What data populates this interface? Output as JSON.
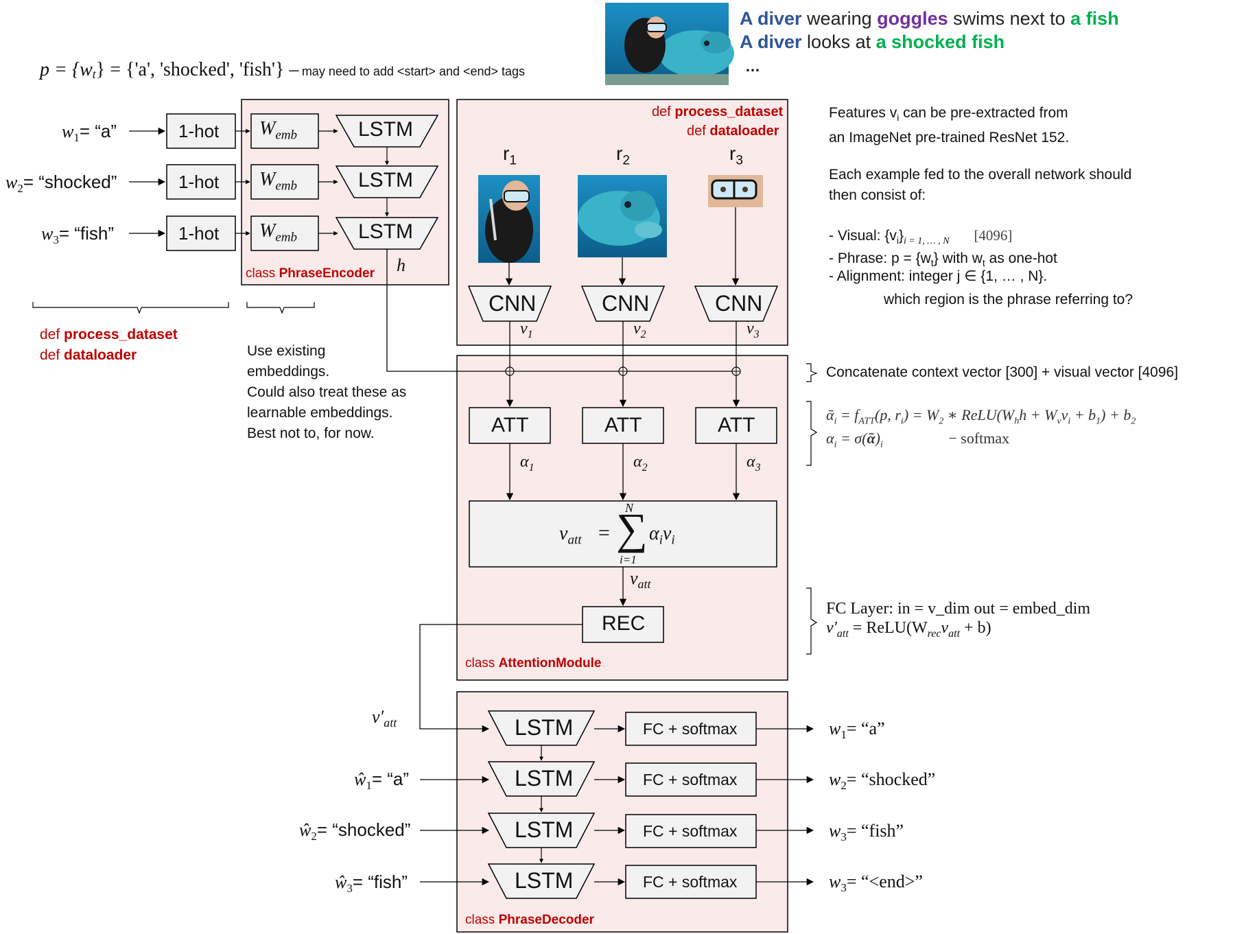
{
  "caption": {
    "line1": {
      "a": "A diver",
      "b": " wearing ",
      "c": "goggles",
      "d": " swims next to ",
      "e": "a fish"
    },
    "line2": {
      "a": "A diver",
      "b": " looks at ",
      "c": "a shocked fish"
    },
    "ellipsis": "…"
  },
  "phrase_def": {
    "formula": "p = {w",
    "sub": "t",
    "formula_end": "} = {'a', 'shocked', 'fish'} –",
    "note": "may need to add <start> and <end> tags"
  },
  "encoder": {
    "inputs": [
      {
        "w": "w",
        "sub": "1",
        "rest": "= “a”"
      },
      {
        "w": "w",
        "sub": "2",
        "rest": "= “shocked”"
      },
      {
        "w": "w",
        "sub": "3",
        "rest": "= “fish”"
      }
    ],
    "onehot_label": "1-hot",
    "wemb_label": "W",
    "wemb_sub": "emb",
    "lstm_label": "LSTM",
    "h_label": "h",
    "class_prefix": "class ",
    "class_name": "PhraseEncoder"
  },
  "left_notes": {
    "def1_prefix": "def ",
    "def1_name": "process_dataset",
    "def2_prefix": "def ",
    "def2_name": "dataloader",
    "embed_note": [
      "Use existing",
      "embeddings.",
      "Could also treat these as",
      "learnable embeddings.",
      "Best not to, for now."
    ]
  },
  "regions": {
    "def1_prefix": "def ",
    "def1_name": "process_dataset",
    "def2_prefix": "def ",
    "def2_name": "dataloader",
    "labels": [
      {
        "r": "r",
        "sub": "1",
        "v": "v",
        "vsub": "1",
        "alpha": "α",
        "asub": "1"
      },
      {
        "r": "r",
        "sub": "2",
        "v": "v",
        "vsub": "2",
        "alpha": "α",
        "asub": "2"
      },
      {
        "r": "r",
        "sub": "3",
        "v": "v",
        "vsub": "3",
        "alpha": "α",
        "asub": "3"
      }
    ],
    "cnn_label": "CNN"
  },
  "attention": {
    "att_label": "ATT",
    "sum_lhs": "v",
    "sum_lhs_sub": "att",
    "sum_eq": "=",
    "sum_top": "N",
    "sum_bottom": "i=1",
    "sum_rhs": "α",
    "sum_rhs_sub": "i",
    "sum_rhs_v": "v",
    "sum_rhs_vsub": "i",
    "vatt": "v",
    "vatt_sub": "att",
    "rec_label": "REC",
    "class_prefix": "class ",
    "class_name": "AttentionModule"
  },
  "right_notes": {
    "features": [
      "Features v",
      "i",
      " can be pre-extracted from",
      "an ImageNet pre-trained ResNet 152."
    ],
    "example_intro": [
      "Each example fed to the overall network should",
      "then consist of:"
    ],
    "visual": "- Visual: {v",
    "visual_sub": "i",
    "visual_end": "}",
    "visual_range": "i = 1, … , N",
    "visual_dim": "[4096]",
    "phrase": "- Phrase: p = {w",
    "phrase_sub": "t",
    "phrase_mid": "} with w",
    "phrase_sub2": "t",
    "phrase_end": " as one-hot",
    "alignment": "- Alignment: integer j ∈ {1, … , N}.",
    "alignment_q": "which region is the phrase referring to?",
    "concat": "Concatenate context vector [300] + visual vector [4096]",
    "att_eq1": "ᾱ",
    "att_eq1_sub": "i",
    "att_eq1_rest": " = f",
    "att_eq1_f_sub": "ATT",
    "att_eq1_tail": "(p, r",
    "att_eq1_tail_sub": "i",
    "att_eq1_tail2": ") = W",
    "att_eq1_w2": "2",
    "att_eq1_relu": " ∗ ReLU(W",
    "att_eq1_h": "h",
    "att_eq1_hh": "h + W",
    "att_eq1_v": "v",
    "att_eq1_vv": "v",
    "att_eq1_vi": "i",
    "att_eq1_b": " + b",
    "att_eq1_b1": "1",
    "att_eq1_b2txt": ") + b",
    "att_eq1_b2": "2",
    "att_eq2": "α",
    "att_eq2_sub": "i",
    "att_eq2_rest": " = σ(",
    "att_eq2_bold": "ᾱ",
    "att_eq2_end": ")",
    "att_eq2_end_sub": "i",
    "att_eq2_note": "− softmax",
    "fc_line": "FC Layer:  in = v_dim   out = embed_dim",
    "fc_eq": "v′",
    "fc_eq_sub": "att",
    "fc_eq_rest": " = ReLU(W",
    "fc_eq_w_sub": "rec",
    "fc_eq_v": "v",
    "fc_eq_v_sub": "att",
    "fc_eq_end": " + b)"
  },
  "decoder": {
    "inputs": [
      {
        "w": "v′",
        "sub": "att",
        "rest": ""
      },
      {
        "w": "ŵ",
        "sub": "1",
        "rest": "= “a”"
      },
      {
        "w": "ŵ",
        "sub": "2",
        "rest": "= “shocked”"
      },
      {
        "w": "ŵ",
        "sub": "3",
        "rest": "= “fish”"
      }
    ],
    "lstm_label": "LSTM",
    "fc_label": "FC + softmax",
    "outputs": [
      {
        "w": "w",
        "sub": "1",
        "rest": "= “a”"
      },
      {
        "w": "w",
        "sub": "2",
        "rest": "= “shocked”"
      },
      {
        "w": "w",
        "sub": "3",
        "rest": "= “fish”"
      },
      {
        "w": "w",
        "sub": "3",
        "rest": "= “<end>”"
      }
    ],
    "class_prefix": "class ",
    "class_name": "PhraseDecoder"
  },
  "colors": {
    "panel_fill": "#fbeaea",
    "box_fill": "#f2f2f2",
    "red": "#c00000",
    "blue": "#2f5597",
    "purple": "#7030a0",
    "green": "#00b050"
  }
}
